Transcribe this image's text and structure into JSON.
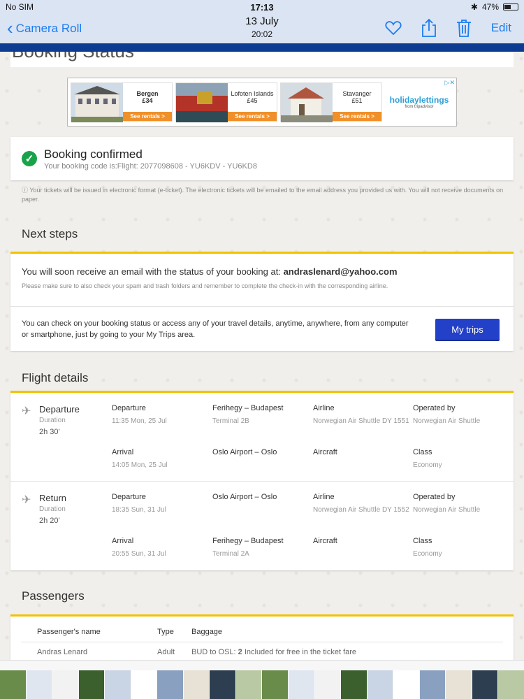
{
  "status_bar": {
    "carrier": "No SIM",
    "time": "17:13",
    "battery": "47%"
  },
  "nav": {
    "back_label": "Camera Roll",
    "date": "13 July",
    "time": "20:02",
    "edit_label": "Edit"
  },
  "page_heading_partial": "Booking Status",
  "ad": {
    "items": [
      {
        "city": "Bergen",
        "price": "£34",
        "cta": "See rentals >"
      },
      {
        "city": "Lofoten Islands",
        "price": "£45",
        "cta": "See rentals >"
      },
      {
        "city": "Stavanger",
        "price": "£51",
        "cta": "See rentals >"
      }
    ],
    "brand": "holidaylettings",
    "brand_sub": "from tripadvisor"
  },
  "confirmation": {
    "title": "Booking confirmed",
    "code_line": "Your booking code is:Flight: 2077098608 - YU6KDV - YU6KD8"
  },
  "notice": "Your tickets will be issued in electronic format (e-ticket). The electronic tickets will be emailed to the email address you provided us with. You will not receive documents on paper.",
  "next_steps": {
    "title": "Next steps",
    "email_prefix": "You will soon receive an email with the status of your booking at: ",
    "email": "andraslenard@yahoo.com",
    "email_note": "Please make sure to also check your spam and trash folders and remember to complete the check-in with the corresponding airline.",
    "trips_text": "You can check on your booking status or access any of your travel details, anytime, anywhere, from any computer or smartphone, just by going to your My Trips area.",
    "trips_button": "My trips"
  },
  "flight_details": {
    "title": "Flight details",
    "segments": [
      {
        "name": "Departure",
        "duration_label": "Duration",
        "duration": "2h 30'",
        "departure_label": "Departure",
        "departure_time": "11:35 Mon, 25 Jul",
        "arrival_label": "Arrival",
        "arrival_time": "14:05 Mon, 25 Jul",
        "from_airport": "Ferihegy – Budapest",
        "from_terminal": "Terminal 2B",
        "to_airport": "Oslo Airport – Oslo",
        "to_terminal": "",
        "airline_label": "Airline",
        "airline": "Norwegian Air Shuttle DY 1551",
        "aircraft_label": "Aircraft",
        "aircraft": "",
        "operated_label": "Operated by",
        "operated": "Norwegian Air Shuttle",
        "class_label": "Class",
        "class": "Economy"
      },
      {
        "name": "Return",
        "duration_label": "Duration",
        "duration": "2h 20'",
        "departure_label": "Departure",
        "departure_time": "18:35 Sun, 31 Jul",
        "arrival_label": "Arrival",
        "arrival_time": "20:55 Sun, 31 Jul",
        "from_airport": "Oslo Airport – Oslo",
        "from_terminal": "",
        "to_airport": "Ferihegy – Budapest",
        "to_terminal": "Terminal 2A",
        "airline_label": "Airline",
        "airline": "Norwegian Air Shuttle DY 1552",
        "aircraft_label": "Aircraft",
        "aircraft": "",
        "operated_label": "Operated by",
        "operated": "Norwegian Air Shuttle",
        "class_label": "Class",
        "class": "Economy"
      }
    ]
  },
  "passengers": {
    "title": "Passengers",
    "headers": [
      "Passenger's name",
      "Type",
      "Baggage"
    ],
    "rows": [
      {
        "name": "Andras Lenard",
        "type": "Adult",
        "baggage_prefix": "BUD to OSL: ",
        "baggage_count": "2",
        "baggage_suffix": " Included for free in the ticket fare"
      }
    ]
  },
  "colors": {
    "accent": "#2340c8",
    "brand_strip": "#0b3c91",
    "highlight": "#f2c200",
    "success": "#18a34a",
    "ios_blue": "#1b7cf2"
  }
}
